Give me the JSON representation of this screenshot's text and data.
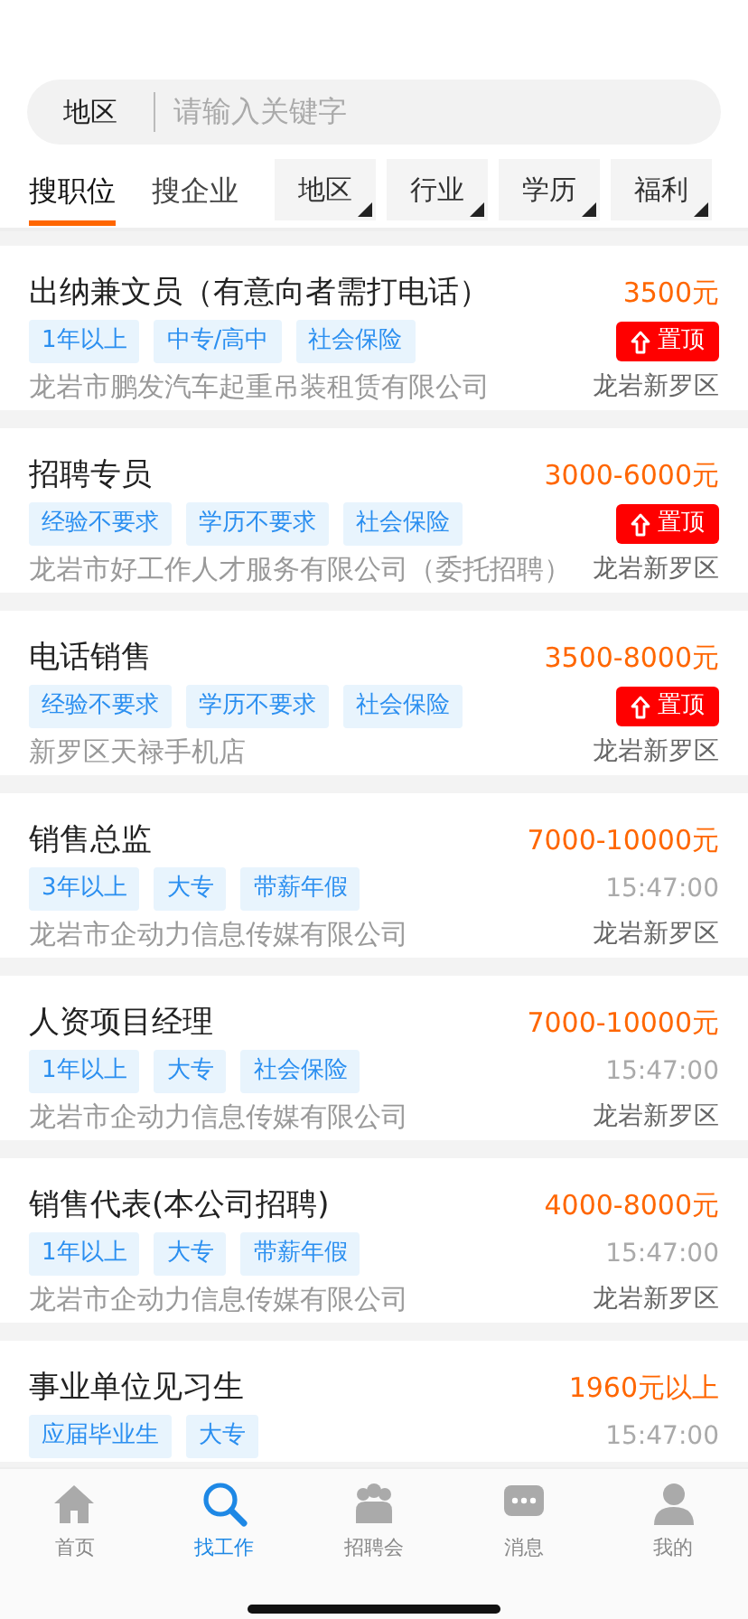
{
  "search": {
    "region": "地区",
    "placeholder": "请输入关键字"
  },
  "tabs": [
    {
      "label": "搜职位",
      "selected": true
    },
    {
      "label": "搜企业",
      "selected": false
    }
  ],
  "filters": [
    "地区",
    "行业",
    "学历",
    "福利"
  ],
  "jobs": [
    {
      "title": "出纳兼文员（有意向者需打电话）",
      "salary": "3500元",
      "tags": [
        "1年以上",
        "中专/高中",
        "社会保险"
      ],
      "pinned": true,
      "pin_label": "置顶",
      "company": "龙岩市鹏发汽车起重吊装租赁有限公司",
      "location": "龙岩新罗区"
    },
    {
      "title": "招聘专员",
      "salary": "3000-6000元",
      "tags": [
        "经验不要求",
        "学历不要求",
        "社会保险"
      ],
      "pinned": true,
      "pin_label": "置顶",
      "company": "龙岩市好工作人才服务有限公司（委托招聘）",
      "location": "龙岩新罗区"
    },
    {
      "title": "电话销售",
      "salary": "3500-8000元",
      "tags": [
        "经验不要求",
        "学历不要求",
        "社会保险"
      ],
      "pinned": true,
      "pin_label": "置顶",
      "company": "新罗区天禄手机店",
      "location": "龙岩新罗区"
    },
    {
      "title": "销售总监",
      "salary": "7000-10000元",
      "tags": [
        "3年以上",
        "大专",
        "带薪年假"
      ],
      "pinned": false,
      "time": "15:47:00",
      "company": "龙岩市企动力信息传媒有限公司",
      "location": "龙岩新罗区"
    },
    {
      "title": "人资项目经理",
      "salary": "7000-10000元",
      "tags": [
        "1年以上",
        "大专",
        "社会保险"
      ],
      "pinned": false,
      "time": "15:47:00",
      "company": "龙岩市企动力信息传媒有限公司",
      "location": "龙岩新罗区"
    },
    {
      "title": "销售代表(本公司招聘)",
      "salary": "4000-8000元",
      "tags": [
        "1年以上",
        "大专",
        "带薪年假"
      ],
      "pinned": false,
      "time": "15:47:00",
      "company": "龙岩市企动力信息传媒有限公司",
      "location": "龙岩新罗区"
    },
    {
      "title": "事业单位见习生",
      "salary": "1960元以上",
      "tags": [
        "应届毕业生",
        "大专"
      ],
      "pinned": false,
      "time": "15:47:00"
    }
  ],
  "nav": [
    {
      "label": "首页",
      "selected": false
    },
    {
      "label": "找工作",
      "selected": true
    },
    {
      "label": "招聘会",
      "selected": false
    },
    {
      "label": "消息",
      "selected": false
    },
    {
      "label": "我的",
      "selected": false
    }
  ]
}
